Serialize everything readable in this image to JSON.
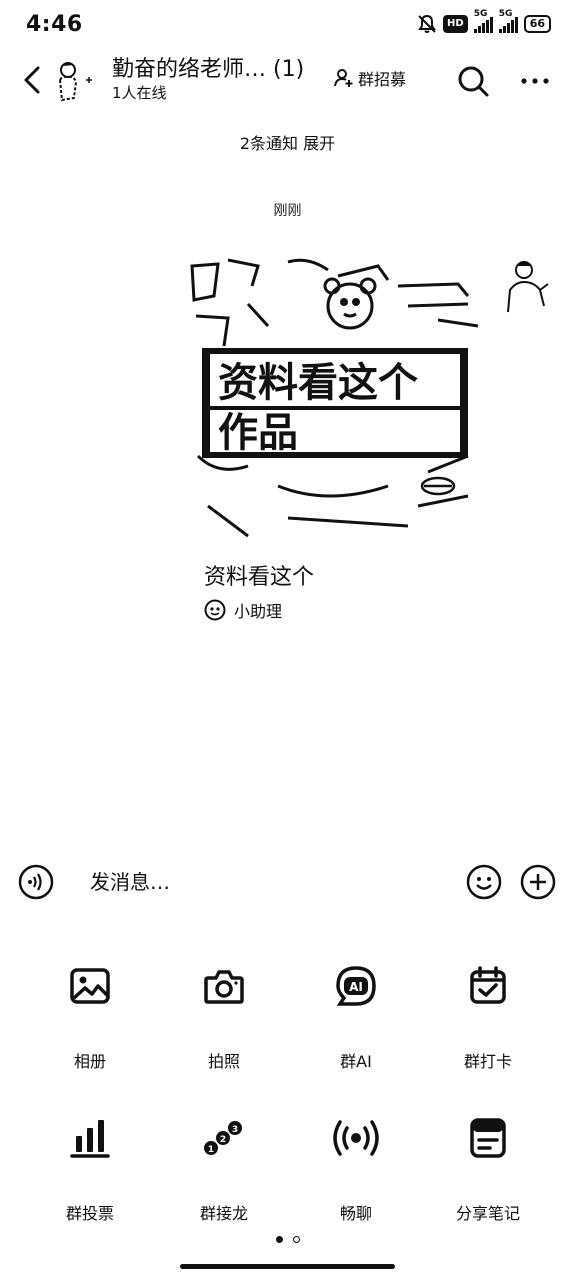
{
  "status_bar": {
    "time": "4:46",
    "hd": "HD",
    "network1": "5G",
    "network2": "5G",
    "battery": "66"
  },
  "header": {
    "group_name": "勤奋的络老师… (1)",
    "online": "1人在线",
    "recruit_label": "群招募"
  },
  "chat": {
    "notice": "2条通知 展开",
    "timestamp": "刚刚",
    "card": {
      "image_text_line1": "资料看这个",
      "image_text_line2": "作品",
      "title": "资料看这个",
      "source": "小助理"
    }
  },
  "input": {
    "placeholder": "发消息…"
  },
  "tools": [
    {
      "label": "相册",
      "icon": "image-icon"
    },
    {
      "label": "拍照",
      "icon": "camera-icon"
    },
    {
      "label": "群AI",
      "icon": "ai-icon"
    },
    {
      "label": "群打卡",
      "icon": "checkin-icon"
    },
    {
      "label": "群投票",
      "icon": "bar-chart-icon"
    },
    {
      "label": "群接龙",
      "icon": "relay-icon"
    },
    {
      "label": "畅聊",
      "icon": "broadcast-icon"
    },
    {
      "label": "分享笔记",
      "icon": "note-icon"
    }
  ],
  "pager": {
    "pages": 2,
    "active": 1
  }
}
